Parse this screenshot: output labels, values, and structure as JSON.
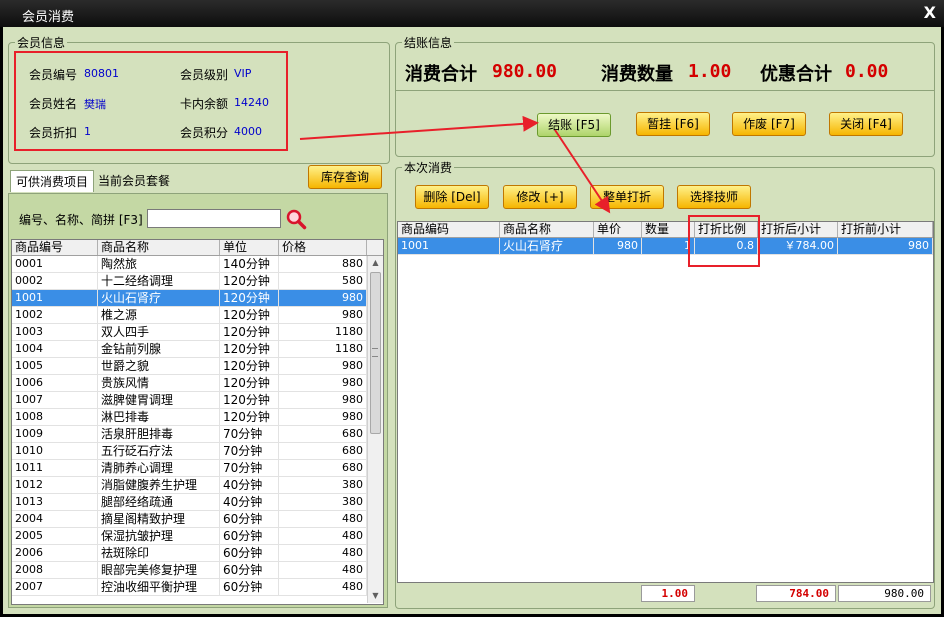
{
  "window": {
    "title": "会员消费",
    "close_glyph": "X"
  },
  "member": {
    "group_title": "会员信息",
    "fields": [
      {
        "label": "会员编号",
        "value": "80801"
      },
      {
        "label": "会员级别",
        "value": "VIP"
      },
      {
        "label": "会员姓名",
        "value": "樊瑞"
      },
      {
        "label": "卡内余额",
        "value": "14240"
      },
      {
        "label": "会员折扣",
        "value": "1"
      },
      {
        "label": "会员积分",
        "value": "4000"
      }
    ]
  },
  "checkout": {
    "group_title": "结账信息",
    "total_label": "消费合计",
    "total_value": "980.00",
    "qty_label": "消费数量",
    "qty_value": "1.00",
    "discount_label": "优惠合计",
    "discount_value": "0.00",
    "buttons": {
      "checkout": "结账 [F5]",
      "suspend": "暂挂 [F6]",
      "void": "作废 [F7]",
      "close": "关闭 [F4]"
    }
  },
  "left": {
    "tabs": [
      "可供消费项目",
      "当前会员套餐"
    ],
    "stock_button": "库存查询",
    "search_label": "编号、名称、简拼 [F3]",
    "search_value": "",
    "columns": [
      "商品编号",
      "商品名称",
      "单位",
      "价格"
    ],
    "rows": [
      [
        "0001",
        "陶然旅",
        "140分钟",
        "880"
      ],
      [
        "0002",
        "十二经络调理",
        "120分钟",
        "580"
      ],
      [
        "1001",
        "火山石肾疗",
        "120分钟",
        "980"
      ],
      [
        "1002",
        "椎之源",
        "120分钟",
        "980"
      ],
      [
        "1003",
        "双人四手",
        "120分钟",
        "1180"
      ],
      [
        "1004",
        "金钻前列腺",
        "120分钟",
        "1180"
      ],
      [
        "1005",
        "世爵之貌",
        "120分钟",
        "980"
      ],
      [
        "1006",
        "贵族风情",
        "120分钟",
        "980"
      ],
      [
        "1007",
        "滋脾健胃调理",
        "120分钟",
        "980"
      ],
      [
        "1008",
        "淋巴排毒",
        "120分钟",
        "980"
      ],
      [
        "1009",
        "活泉肝胆排毒",
        "70分钟",
        "680"
      ],
      [
        "1010",
        "五行砭石疗法",
        "70分钟",
        "680"
      ],
      [
        "1011",
        "清肺养心调理",
        "70分钟",
        "680"
      ],
      [
        "1012",
        "消脂健腹养生护理",
        "40分钟",
        "380"
      ],
      [
        "1013",
        "腿部经络疏通",
        "40分钟",
        "380"
      ],
      [
        "2004",
        "摘星阁精致护理",
        "60分钟",
        "480"
      ],
      [
        "2005",
        "保湿抗皱护理",
        "60分钟",
        "480"
      ],
      [
        "2006",
        "祛斑除印",
        "60分钟",
        "480"
      ],
      [
        "2008",
        "眼部完美修复护理",
        "60分钟",
        "480"
      ],
      [
        "2007",
        "控油收细平衡护理",
        "60分钟",
        "480"
      ]
    ],
    "selected_index": 2
  },
  "consume": {
    "group_title": "本次消费",
    "buttons": {
      "delete": "删除 [Del]",
      "edit": "修改 [+]",
      "whole_discount": "整单打折",
      "select_tech": "选择技师"
    },
    "columns": [
      "商品编码",
      "商品名称",
      "单价",
      "数量",
      "打折比例",
      "打折后小计",
      "打折前小计"
    ],
    "rows": [
      [
        "1001",
        "火山石肾疗",
        "980",
        "1",
        "0.8",
        "￥784.00",
        "980"
      ]
    ],
    "footer": {
      "qty": "1.00",
      "after": "784.00",
      "before": "980.00"
    }
  },
  "colors": {
    "accent_red": "#e8202a",
    "selection": "#3a8ee6",
    "panel_green": "#d4e1bd"
  }
}
